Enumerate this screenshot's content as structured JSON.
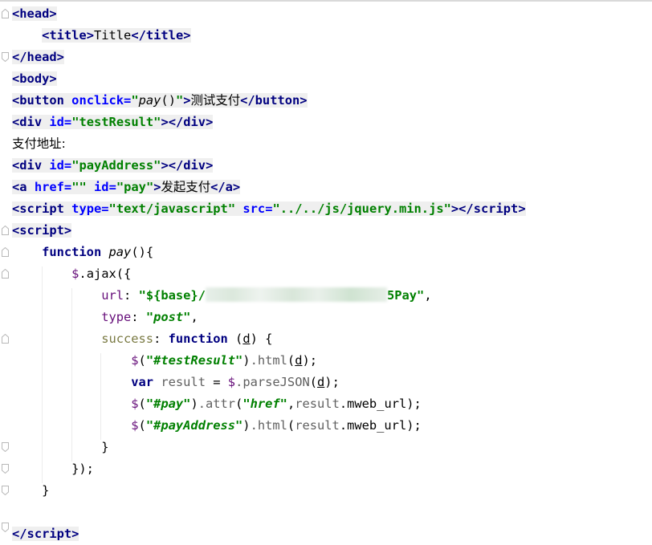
{
  "editor": {
    "lines": {
      "l1": {
        "tag": "head"
      },
      "l2": {
        "open": "title",
        "text": "Title",
        "close": "title"
      },
      "l3": {
        "tag": "head"
      },
      "l4": {
        "tag": "body"
      },
      "l5": {
        "tag": "button",
        "attr": "onclick",
        "fn": "pay",
        "parens": "()",
        "text": "测试支付",
        "close": "button"
      },
      "l6": {
        "tag": "div",
        "attr": "id",
        "value": "testResult",
        "close": "div"
      },
      "l7": {
        "text": "支付地址:"
      },
      "l8": {
        "tag": "div",
        "attr": "id",
        "value": "payAddress",
        "close": "div"
      },
      "l9": {
        "tag": "a",
        "attr1": "href",
        "attr2": "id",
        "value2": "pay",
        "text": "发起支付",
        "close": "a"
      },
      "l10": {
        "tag": "script",
        "attr1": "type",
        "value1": "text/javascript",
        "attr2": "src",
        "value2": "../../js/jquery.min.js",
        "close": "script"
      },
      "l11": {
        "tag": "script"
      },
      "l12": {
        "keyword": "function",
        "name": "pay",
        "rest": "(){"
      },
      "l13": {
        "obj": "$",
        "method": ".ajax",
        "rest": "({"
      },
      "l14": {
        "key": "url",
        "value_start": "\"${base}/",
        "value_end": "5Pay\"",
        "comma": ","
      },
      "l15": {
        "key": "type",
        "value": "\"post\"",
        "comma": ","
      },
      "l16": {
        "key": "success",
        "keyword": "function",
        "param": "d",
        "rest": "{"
      },
      "l17": {
        "obj": "$",
        "selector": "\"#testResult\"",
        "method": ".html",
        "arg": "d",
        "end": ");"
      },
      "l18": {
        "keyword": "var",
        "varname": "result",
        "eq": " = ",
        "obj": "$",
        "method": ".parseJSON",
        "arg": "d",
        "end": ");"
      },
      "l19": {
        "obj": "$",
        "selector": "\"#pay\"",
        "method": ".attr",
        "arg1": "\"href\"",
        "arg2": "result",
        "prop": ".mweb_url",
        "end": ");"
      },
      "l20": {
        "obj": "$",
        "selector": "\"#payAddress\"",
        "method": ".html",
        "arg": "result",
        "prop": ".mweb_url",
        "end": ");"
      },
      "l21": {
        "text": "}"
      },
      "l22": {
        "text": "});"
      },
      "l23": {
        "text": "}"
      },
      "l25": {
        "tag": "script"
      }
    }
  }
}
